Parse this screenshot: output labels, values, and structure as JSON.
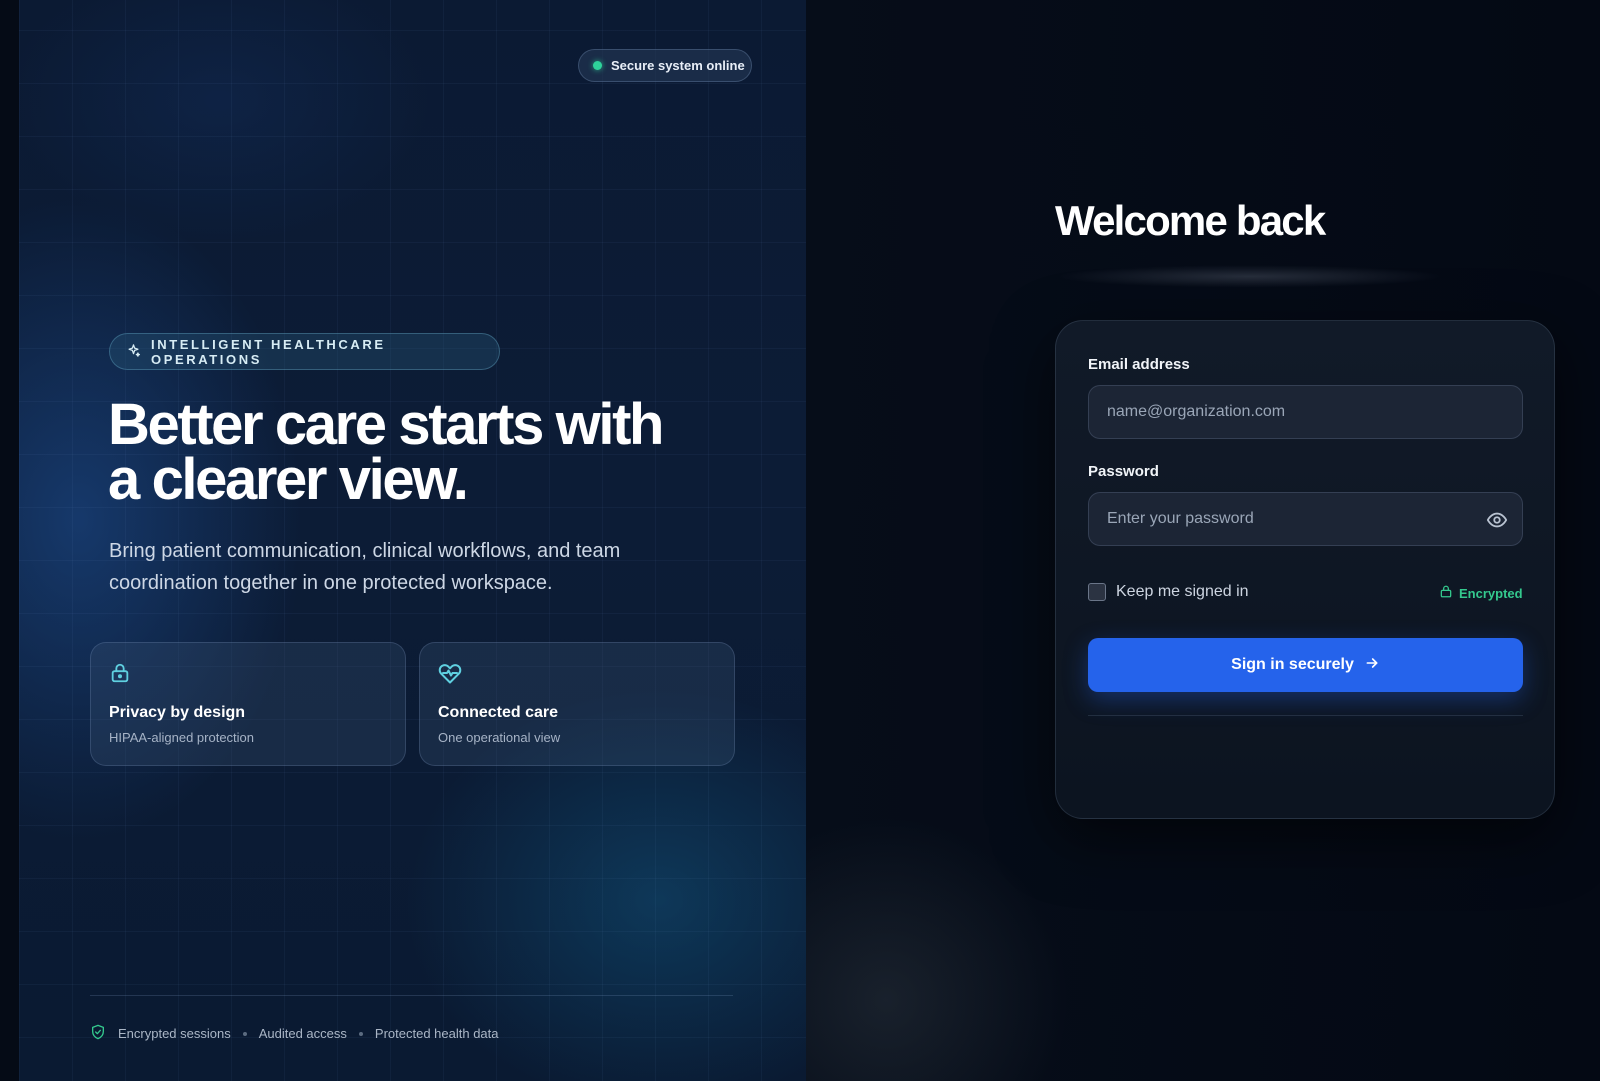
{
  "status": {
    "label": "Secure system online",
    "dot_color": "#2ed39a"
  },
  "hero": {
    "tag": "INTELLIGENT HEALTHCARE OPERATIONS",
    "title_line1": "Better care starts with",
    "title_line2": "a clearer view.",
    "subtitle": "Bring patient communication, clinical workflows, and team coordination together in one protected workspace."
  },
  "features": [
    {
      "icon": "lock-icon",
      "title": "Privacy by design",
      "subtitle": "HIPAA-aligned protection"
    },
    {
      "icon": "heart-pulse-icon",
      "title": "Connected care",
      "subtitle": "One operational view"
    }
  ],
  "footer": {
    "icon": "shield-check-icon",
    "items": [
      "Encrypted sessions",
      "Audited access",
      "Protected health data"
    ]
  },
  "login": {
    "heading": "Welcome back",
    "email_label": "Email address",
    "email_placeholder": "name@organization.com",
    "email_value": "",
    "password_label": "Password",
    "password_placeholder": "Enter your password",
    "password_value": "",
    "remember_label": "Keep me signed in",
    "remember_checked": false,
    "encrypted_label": "Encrypted",
    "submit_label": "Sign in securely"
  },
  "colors": {
    "accent": "#2563eb",
    "success": "#34c98e",
    "icon_teal": "#5fd0e0"
  }
}
